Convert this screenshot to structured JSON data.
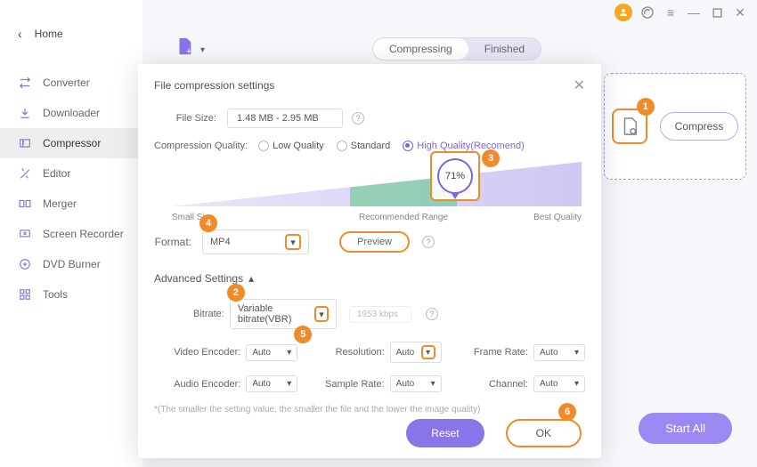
{
  "home_label": "Home",
  "sidebar": {
    "items": [
      {
        "label": "Converter"
      },
      {
        "label": "Downloader"
      },
      {
        "label": "Compressor"
      },
      {
        "label": "Editor"
      },
      {
        "label": "Merger"
      },
      {
        "label": "Screen Recorder"
      },
      {
        "label": "DVD Burner"
      },
      {
        "label": "Tools"
      }
    ]
  },
  "tabs": {
    "compressing": "Compressing",
    "finished": "Finished"
  },
  "right_panel": {
    "compress": "Compress"
  },
  "start_all": "Start All",
  "annotations": {
    "n1": "1",
    "n2": "2",
    "n3": "3",
    "n4": "4",
    "n5": "5",
    "n6": "6"
  },
  "modal": {
    "title": "File compression settings",
    "file_size_label": "File Size:",
    "file_size_value": "1.48 MB - 2.95 MB",
    "cq_label": "Compression Quality:",
    "cq_low": "Low Quality",
    "cq_std": "Standard",
    "cq_high": "High Quality(Recomend)",
    "percent": "71%",
    "q_small": "Small Size",
    "q_rec": "Recommended Range",
    "q_best": "Best Quality",
    "format_label": "Format:",
    "format_value": "MP4",
    "preview": "Preview",
    "adv_title": "Advanced Settings",
    "bitrate_label": "Bitrate:",
    "bitrate_value": "Variable bitrate(VBR)",
    "bitrate_kbps": "1953 kbps",
    "ve_label": "Video Encoder:",
    "ve_value": "Auto",
    "res_label": "Resolution:",
    "res_value": "Auto",
    "fr_label": "Frame Rate:",
    "fr_value": "Auto",
    "ae_label": "Audio Encoder:",
    "ae_value": "Auto",
    "sr_label": "Sample Rate:",
    "sr_value": "Auto",
    "ch_label": "Channel:",
    "ch_value": "Auto",
    "hint": "*(The smaller the setting value, the smaller the file and the lower the image quality)",
    "reset": "Reset",
    "ok": "OK"
  },
  "chart_data": {
    "type": "area",
    "slider_percent": 71,
    "x_range_percent": [
      0,
      100
    ],
    "recommended_range_percent": [
      43,
      70
    ],
    "labels": {
      "left": "Small Size",
      "mid": "Recommended Range",
      "right": "Best Quality"
    }
  }
}
